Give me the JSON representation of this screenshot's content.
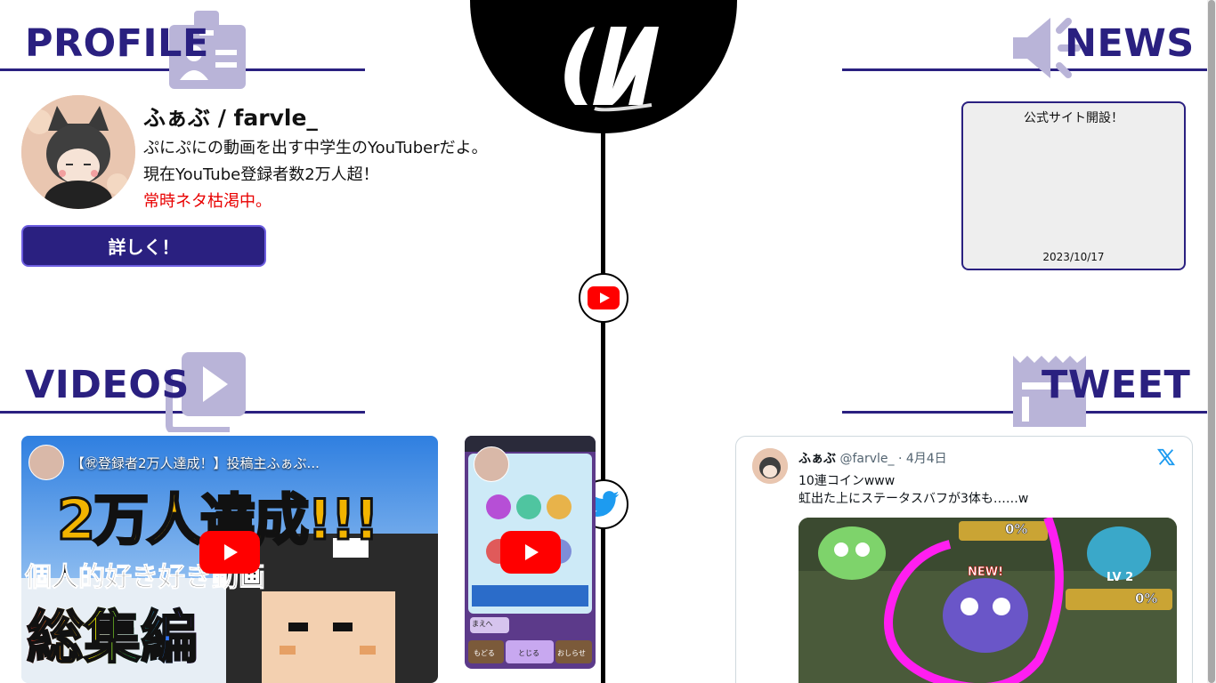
{
  "logo": {
    "text": "ιυ"
  },
  "sections": {
    "profile": "PROFILE",
    "news": "NEWS",
    "videos": "VIDEOS",
    "tweet": "TWEET"
  },
  "profile": {
    "name": "ふぁぶ / farvle_",
    "line1": "ぷにぷにの動画を出す中学生のYouTuberだよ。",
    "line2": "現在YouTube登録者数2万人超！",
    "line3": "常時ネタ枯渇中。",
    "more_button": "詳しく！"
  },
  "news": {
    "title": "公式サイト開設！",
    "date": "2023/10/17"
  },
  "videos": [
    {
      "title": "【㊗登録者2万人達成！】投稿主ふぁぶ...",
      "thumb_text_big": "2万人達成!!!",
      "thumb_text_mid": "個人的好き好き動画",
      "thumb_text_rainbow": "総集編"
    },
    {
      "title": "",
      "game_buttons": [
        "まえへ",
        "もどる",
        "とじる",
        "おしらせ"
      ]
    }
  ],
  "tweet": {
    "display_name": "ふぁぶ",
    "handle": "@farvle_",
    "date": "· 4月4日",
    "line1": "10連コインwww",
    "line2": "虹出た上にステータスバフが3体も……w",
    "image_labels": [
      "0%",
      "NEW!",
      "0%",
      "LV 2"
    ]
  },
  "colors": {
    "accent": "#2a2080",
    "button_border": "#6d5ee0",
    "red_text": "#e80000",
    "icon_lavender": "#b9b4d8",
    "youtube_red": "#ff0000",
    "twitter_blue": "#1d9bf0"
  }
}
